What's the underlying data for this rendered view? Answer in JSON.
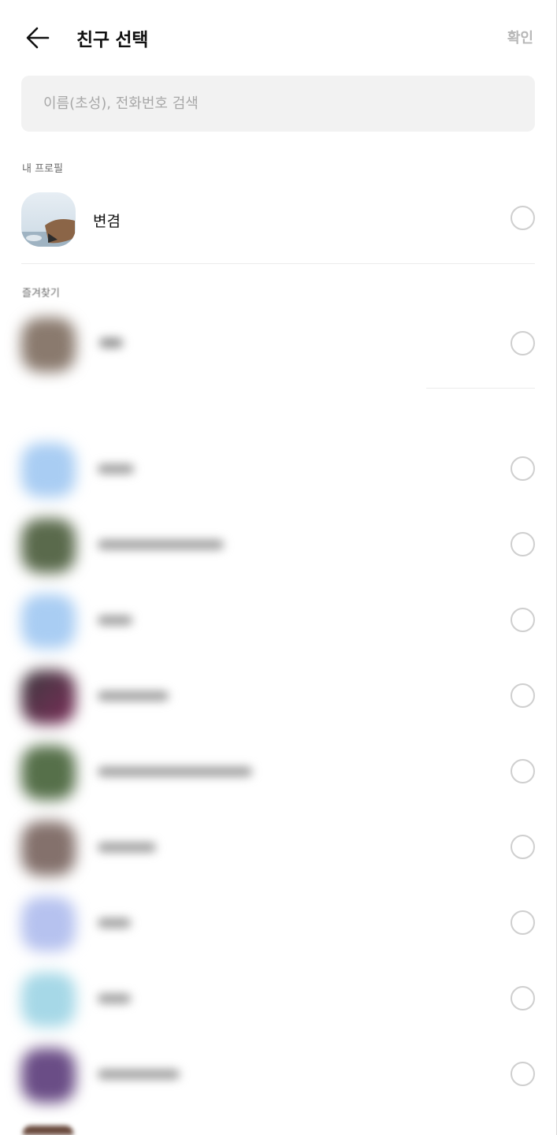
{
  "header": {
    "title": "친구 선택",
    "confirm_label": "확인"
  },
  "search": {
    "placeholder": "이름(초성), 전화번호 검색"
  },
  "sections": {
    "my_profile": "내 프로필",
    "favorites": "즐겨찾기"
  },
  "my_profile": {
    "name": "변겸"
  },
  "favorites": [
    {
      "avatar_color": "#8a7a6e"
    }
  ],
  "friends": [
    {
      "avatar_color": "#a9cdf3"
    },
    {
      "avatar_color": "#5a6a4c"
    },
    {
      "avatar_color": "#a9cdf3"
    },
    {
      "avatar_color": "#5b3e52"
    },
    {
      "avatar_color": "#56704a"
    },
    {
      "avatar_color": "#84716c"
    },
    {
      "avatar_color": "#b6c2ef"
    },
    {
      "avatar_color": "#a6d8e7"
    },
    {
      "avatar_color": "#6a4d86"
    }
  ]
}
